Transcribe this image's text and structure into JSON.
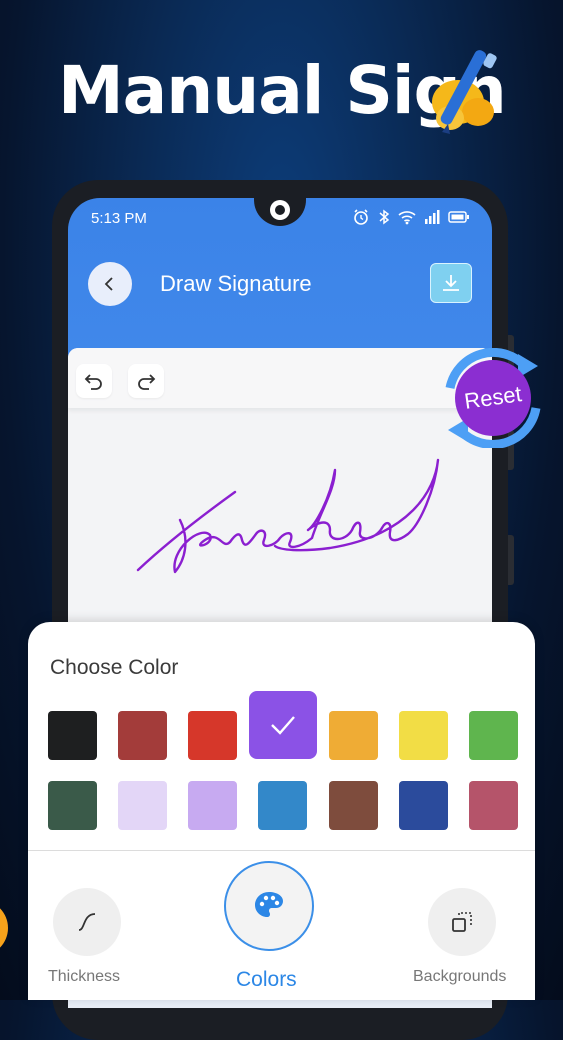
{
  "promo": {
    "headline": "Manual Sign"
  },
  "status_bar": {
    "time": "5:13 PM"
  },
  "app_bar": {
    "title": "Draw Signature"
  },
  "reset_badge": {
    "label": "Reset"
  },
  "color_panel": {
    "title": "Choose Color",
    "selected_index": 3,
    "colors": [
      "#1e1f20",
      "#a33c3a",
      "#d6372a",
      "#8b52e6",
      "#efac35",
      "#f2dd45",
      "#5fb54e",
      "#3a5a49",
      "#e3d6f7",
      "#c7aaf1",
      "#3388c9",
      "#7e4c3d",
      "#2b4b9c",
      "#b5546a"
    ]
  },
  "signature": {
    "ink_color": "#8b1fd0"
  },
  "bottom_nav": {
    "items": [
      {
        "label": "Thickness",
        "icon": "curve-icon"
      },
      {
        "label": "Colors",
        "icon": "palette-icon",
        "active": true
      },
      {
        "label": "Backgrounds",
        "icon": "layers-icon"
      }
    ]
  },
  "theme": {
    "accent": "#2c87e6",
    "app_bar": "#3b83e8"
  }
}
